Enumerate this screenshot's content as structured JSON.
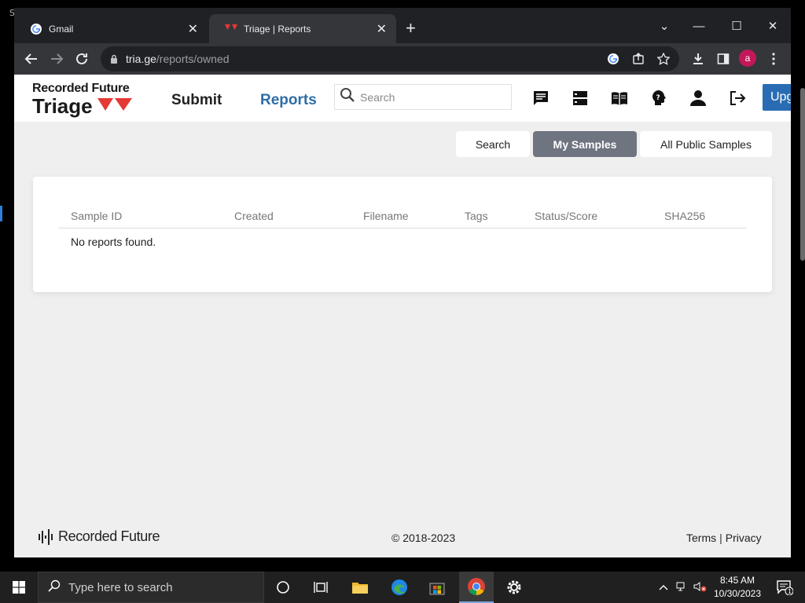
{
  "browser": {
    "tabs": [
      {
        "title": "Gmail",
        "active": false,
        "favicon": "google-icon"
      },
      {
        "title": "Triage | Reports",
        "active": true,
        "favicon": "triage-icon"
      }
    ],
    "url_domain": "tria.ge",
    "url_path": "/reports/owned",
    "profile_initial": "a"
  },
  "header": {
    "brand_top": "Recorded Future",
    "brand_main": "Triage",
    "nav": {
      "submit": "Submit",
      "reports": "Reports"
    },
    "search_placeholder": "Search",
    "upgrade_label": "Upg"
  },
  "filters": {
    "search": "Search",
    "my_samples": "My Samples",
    "all_public": "All Public Samples"
  },
  "table": {
    "columns": [
      "Sample ID",
      "Created",
      "Filename",
      "Tags",
      "Status/Score",
      "SHA256"
    ],
    "empty_message": "No reports found."
  },
  "footer": {
    "brand": "Recorded Future",
    "copyright": "© 2018-2023",
    "terms": "Terms",
    "privacy": "Privacy"
  },
  "taskbar": {
    "search_placeholder": "Type here to search",
    "time": "8:45 AM",
    "date": "10/30/2023",
    "notification_count": "1"
  },
  "colors": {
    "accent_blue": "#2f6da6",
    "triage_red": "#e53935",
    "active_segment": "#6e7480"
  }
}
